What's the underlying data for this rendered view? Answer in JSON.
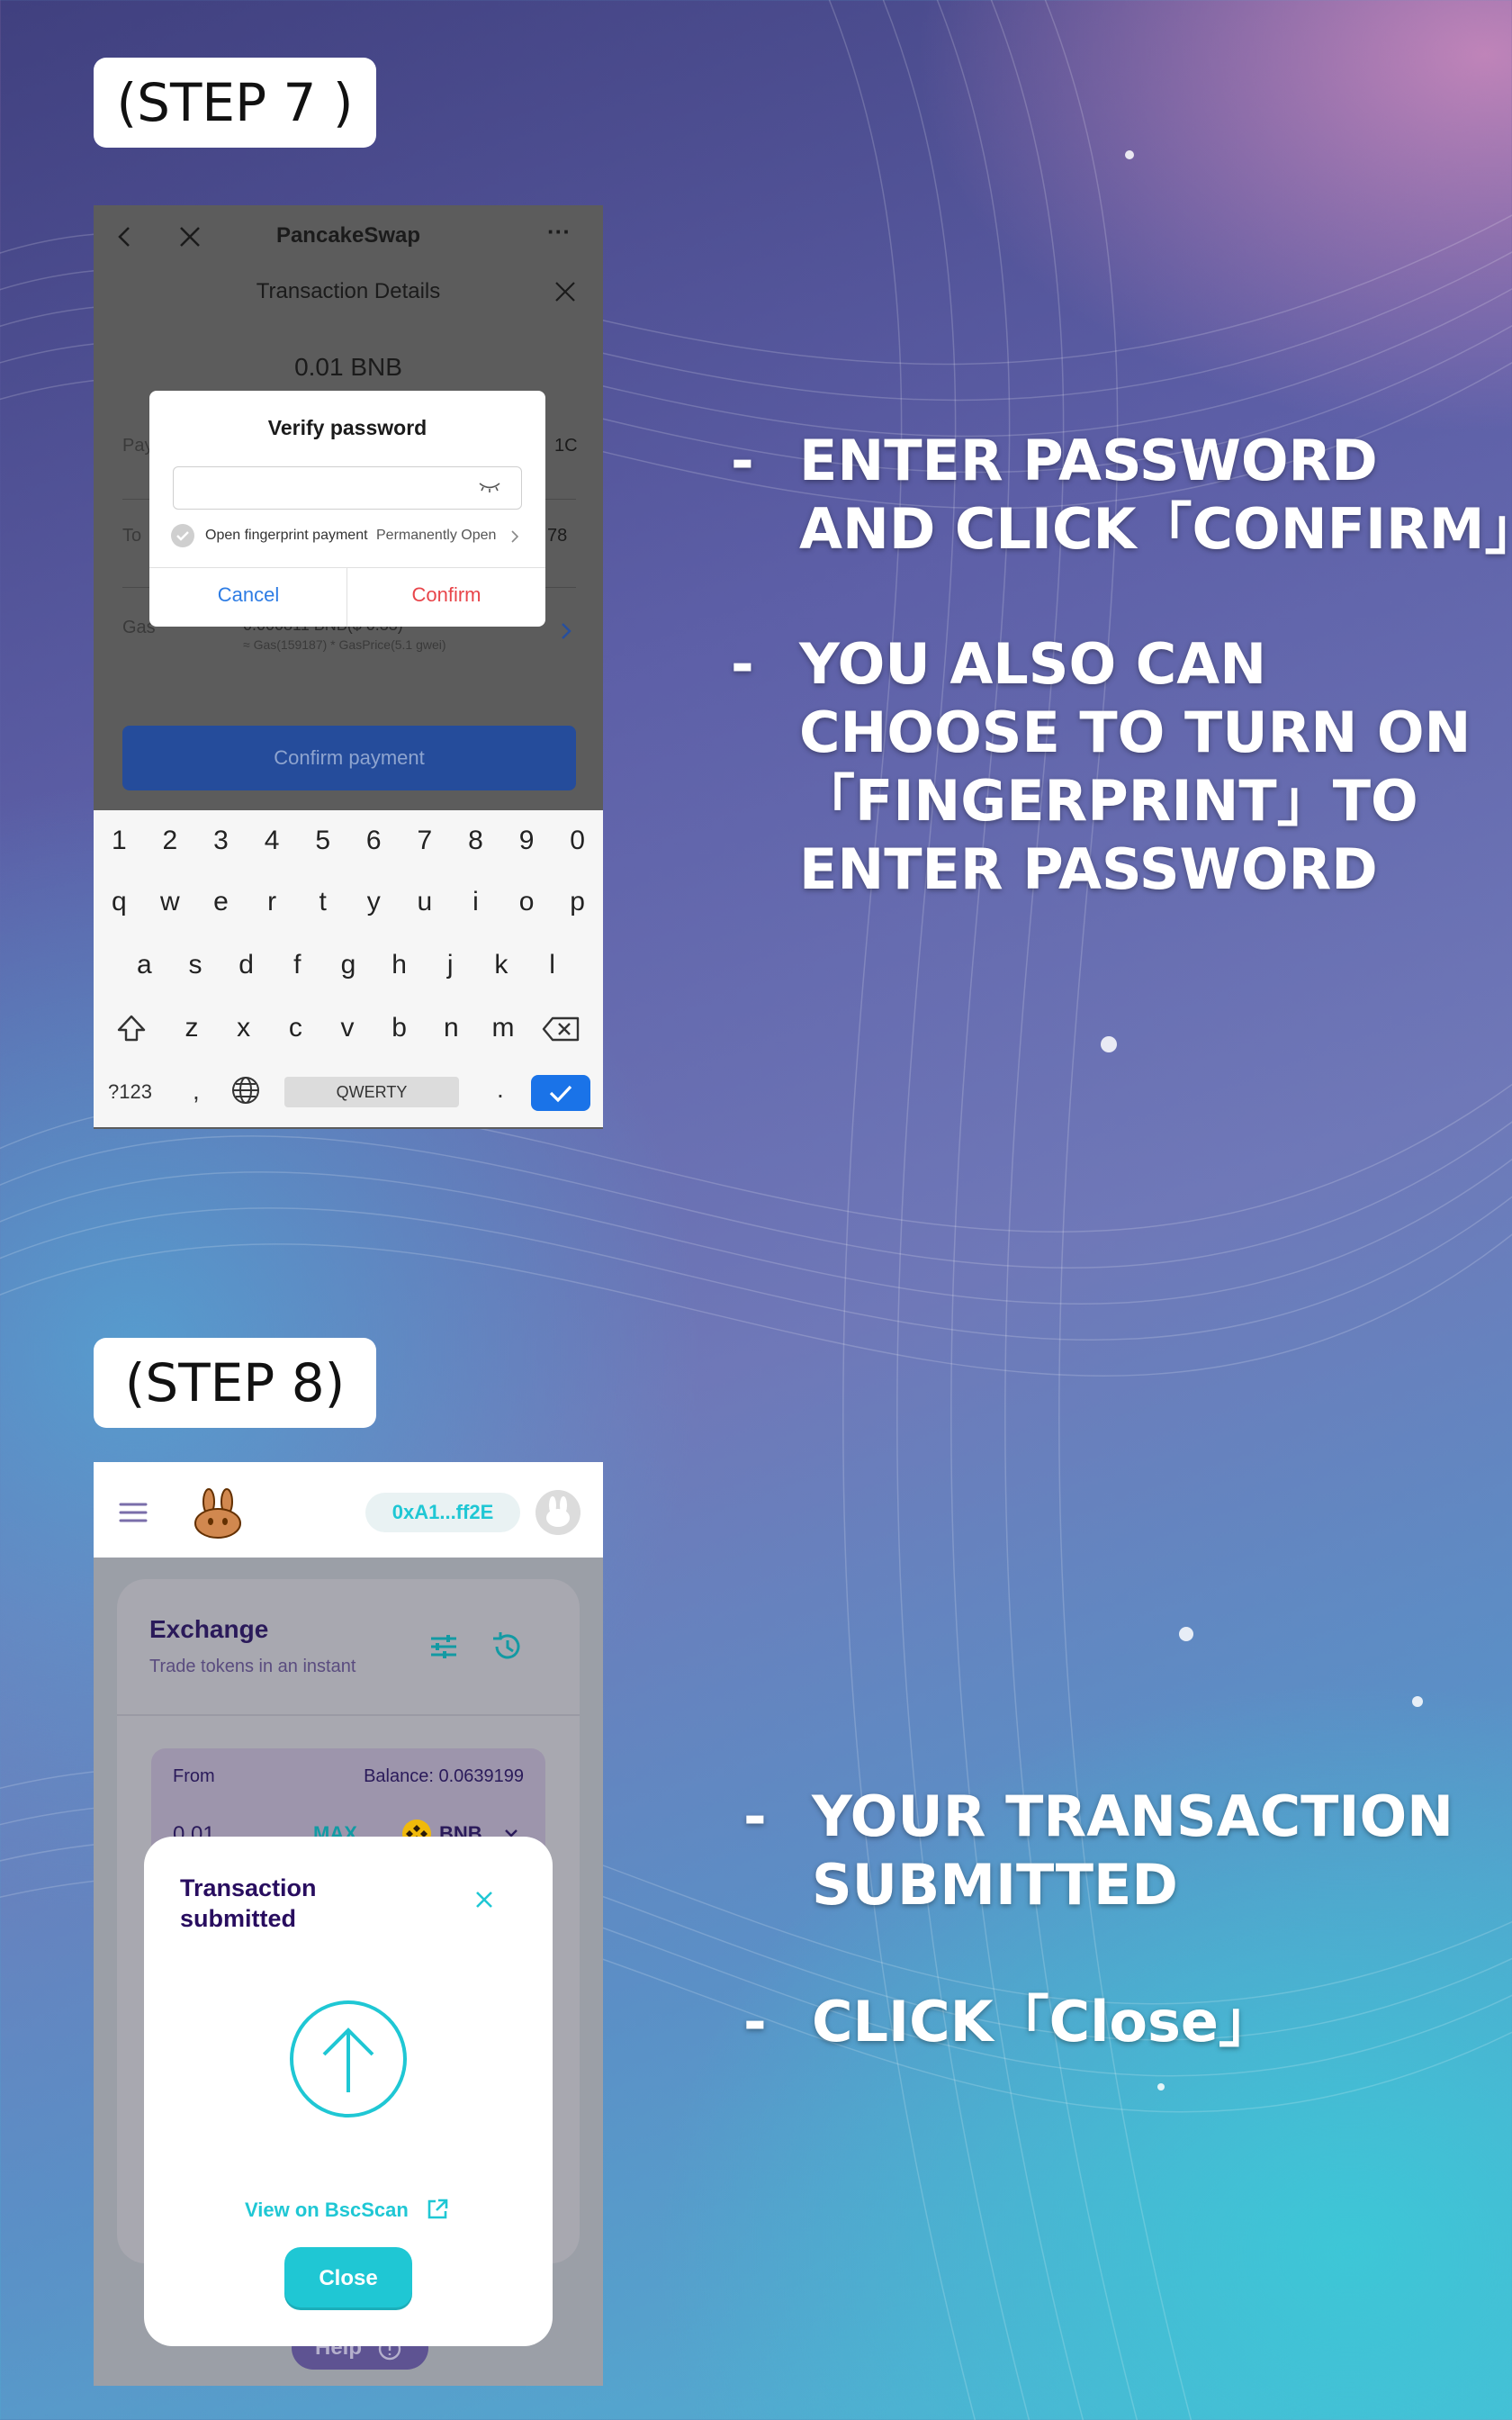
{
  "step7": {
    "label": "(STEP 7 )",
    "phone": {
      "app_title": "PancakeSwap",
      "sheet_title": "Transaction Details",
      "amount": "0.01 BNB",
      "rows": [
        {
          "label": "Pay",
          "value": "1C"
        },
        {
          "label": "To",
          "value": "78"
        }
      ],
      "gas": {
        "label": "Gas",
        "value": "0.000811 BNB($ 0.33)",
        "detail": "≈ Gas(159187) * GasPrice(5.1 gwei)"
      },
      "confirm_payment": "Confirm payment",
      "dialog": {
        "title": "Verify password",
        "password_value": "",
        "fingerprint_label": "Open fingerprint payment",
        "fingerprint_action": "Permanently Open",
        "cancel": "Cancel",
        "confirm": "Confirm"
      },
      "keyboard": {
        "numbers": [
          "1",
          "2",
          "3",
          "4",
          "5",
          "6",
          "7",
          "8",
          "9",
          "0"
        ],
        "row1": [
          "q",
          "w",
          "e",
          "r",
          "t",
          "y",
          "u",
          "i",
          "o",
          "p"
        ],
        "row2": [
          "a",
          "s",
          "d",
          "f",
          "g",
          "h",
          "j",
          "k",
          "l"
        ],
        "row3": [
          "z",
          "x",
          "c",
          "v",
          "b",
          "n",
          "m"
        ],
        "symbols_key": "?123",
        "comma": ",",
        "space_label": "QWERTY",
        "period": "."
      }
    },
    "instructions": [
      {
        "dash": "-",
        "text": "ENTER PASSWORD\nAND CLICK「CONFIRM」"
      },
      {
        "dash": "-",
        "text": "YOU ALSO CAN\nCHOOSE TO TURN ON\n「FINGERPRINT」TO\nENTER PASSWORD"
      }
    ]
  },
  "step8": {
    "label": "(STEP 8)",
    "phone": {
      "wallet_address": "0xA1...ff2E",
      "exchange_title": "Exchange",
      "exchange_subtitle": "Trade tokens in an instant",
      "from_label": "From",
      "balance": "Balance: 0.0639199",
      "from_amount": "0.01",
      "max_label": "MAX",
      "token": "BNB",
      "help_label": "Help",
      "modal": {
        "title": "Transaction\nsubmitted",
        "link": "View on BscScan",
        "close": "Close"
      }
    },
    "instructions": [
      {
        "dash": "-",
        "text": "YOUR TRANSACTION\nSUBMITTED"
      },
      {
        "dash": "-",
        "text": "CLICK「Close」"
      }
    ]
  },
  "colors": {
    "pancake_teal": "#1fc7d4",
    "pancake_purple": "#280d5f",
    "dialog_confirm_red": "#e8454a",
    "dialog_cancel_blue": "#2d7ce4",
    "keyboard_enter_blue": "#1a73e8"
  },
  "icons": [
    "back-arrow-icon",
    "close-icon",
    "more-icon",
    "eye-closed-icon",
    "check-circle-icon",
    "chevron-right-icon",
    "shift-icon",
    "backspace-icon",
    "globe-icon",
    "check-icon",
    "menu-icon",
    "bunny-logo-icon",
    "avatar-icon",
    "settings-sliders-icon",
    "history-icon",
    "bnb-token-icon",
    "chevron-down-icon",
    "arrow-up-circle-icon",
    "external-link-icon",
    "help-icon"
  ]
}
